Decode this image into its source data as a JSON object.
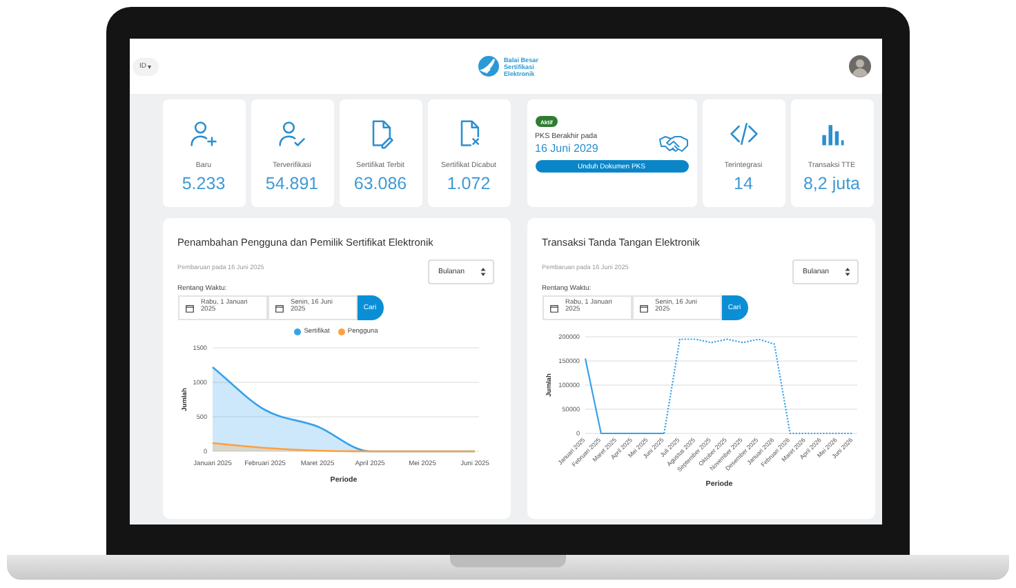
{
  "header": {
    "language": "ID",
    "caret": "▾",
    "logo_lines": [
      "Balai Besar",
      "Sertifikasi",
      "Elektronik"
    ]
  },
  "stats": [
    {
      "kind": "user-add",
      "label": "Baru",
      "value": "5.233"
    },
    {
      "kind": "user-check",
      "label": "Terverifikasi",
      "value": "54.891"
    },
    {
      "kind": "doc-edit",
      "label": "Sertifikat Terbit",
      "value": "63.086"
    },
    {
      "kind": "doc-remove",
      "label": "Sertifikat Dicabut",
      "value": "1.072"
    }
  ],
  "pks": {
    "badge": "Aktif",
    "label": "PKS Berakhir pada",
    "date": "16 Juni 2029",
    "button": "Unduh Dokumen PKS"
  },
  "stats_right": [
    {
      "kind": "code",
      "label": "Terintegrasi",
      "value": "14"
    },
    {
      "kind": "bars",
      "label": "Transaksi TTE",
      "value": "8,2 juta"
    }
  ],
  "charts": [
    {
      "title": "Penambahan Pengguna dan Pemilik Sertifikat Elektronik",
      "updated": "Pembaruan pada 16 Juni 2025",
      "period": "Bulanan",
      "range_label": "Rentang Waktu:",
      "start": "Rabu, 1 Januari 2025",
      "end": "Senin, 16 Juni 2025",
      "search": "Cari",
      "chart_data": {
        "type": "area",
        "xlabel": "Periode",
        "ylabel": "Jumlah",
        "categories": [
          "Januari 2025",
          "Februari 2025",
          "Maret 2025",
          "April 2025",
          "Mei 2025",
          "Juni 2025"
        ],
        "series": [
          {
            "name": "Sertifikat",
            "color": "#36a2eb",
            "values": [
              1220,
              600,
              360,
              0,
              0,
              0
            ]
          },
          {
            "name": "Pengguna",
            "color": "#ff9f40",
            "values": [
              120,
              50,
              10,
              0,
              0,
              0
            ]
          }
        ],
        "ylim": [
          0,
          1500
        ],
        "yticks": [
          0,
          500,
          1000,
          1500
        ],
        "grid": true
      }
    },
    {
      "title": "Transaksi Tanda Tangan Elektronik",
      "updated": "Pembaruan pada 16 Juni 2025",
      "period": "Bulanan",
      "range_label": "Rentang Waktu:",
      "start": "Rabu, 1 Januari 2025",
      "end": "Senin, 16 Juni 2025",
      "search": "Cari",
      "chart_data": {
        "type": "line",
        "xlabel": "Periode",
        "ylabel": "Jumlah",
        "categories": [
          "Januari 2025",
          "Februari 2025",
          "Maret 2025",
          "April 2025",
          "Mei 2025",
          "Juni 2025",
          "Juli 2025",
          "Agustus 2025",
          "September 2025",
          "Oktober 2025",
          "November 2025",
          "Desember 2025",
          "Januari 2026",
          "Februari 2026",
          "Maret 2026",
          "April 2026",
          "Mei 2026",
          "Juni 2026"
        ],
        "series": [
          {
            "line_style": "solid",
            "color": "#36a2eb",
            "values": [
              155000,
              0,
              0,
              0,
              0,
              0,
              null,
              null,
              null,
              null,
              null,
              null,
              null,
              null,
              null,
              null,
              null,
              null
            ]
          },
          {
            "line_style": "dotted",
            "color": "#36a2eb",
            "values": [
              null,
              null,
              null,
              null,
              null,
              0,
              195000,
              195000,
              188000,
              195000,
              188000,
              195000,
              185000,
              0,
              0,
              0,
              0,
              0
            ]
          }
        ],
        "ylim": [
          0,
          200000
        ],
        "yticks": [
          0,
          50000,
          100000,
          150000,
          200000
        ],
        "grid": true
      }
    }
  ]
}
